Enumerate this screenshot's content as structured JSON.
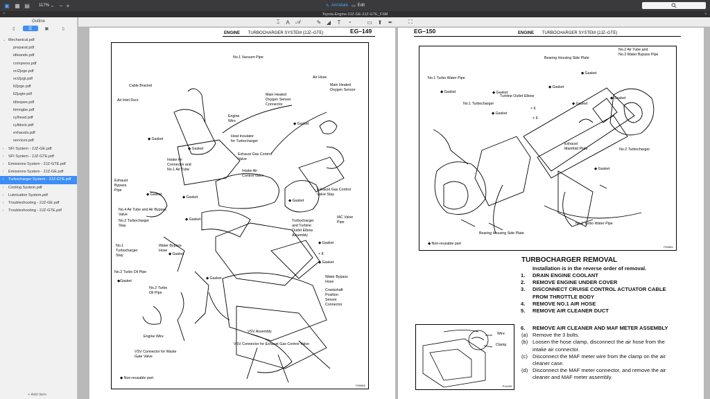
{
  "toolbar": {
    "zoom": "117%",
    "annotate_label": "Annotate",
    "edit_label": "Edit"
  },
  "window": {
    "title": "Toyota-Engine-2JZ-GE-2JZ-GTE_FSM"
  },
  "sidebar": {
    "title": "Outline",
    "items": [
      {
        "label": "Mechanical.pdf",
        "level": 0,
        "expanded": true
      },
      {
        "label": "preparat.pdf",
        "level": 1
      },
      {
        "label": "idleando.pdf",
        "level": 1
      },
      {
        "label": "compress.pdf",
        "level": 1
      },
      {
        "label": "vci2jzge.pdf",
        "level": 1
      },
      {
        "label": "vci2jzgt.pdf",
        "level": 1
      },
      {
        "label": "lt2jzge.pdf",
        "level": 1
      },
      {
        "label": "lt2jzgte.pdf",
        "level": 1
      },
      {
        "label": "idlespee.pdf",
        "level": 1
      },
      {
        "label": "timingbe.pdf",
        "level": 1
      },
      {
        "label": "cylhead.pdf",
        "level": 1
      },
      {
        "label": "cylblock.pdf",
        "level": 1
      },
      {
        "label": "exhausts.pdf",
        "level": 1
      },
      {
        "label": "services.pdf",
        "level": 1
      },
      {
        "label": "SFI System - 2JZ-GE.pdf",
        "level": 0
      },
      {
        "label": "SFI System - 2JZ-GTE.pdf",
        "level": 0
      },
      {
        "label": "Emissions System - 2JZ-GTE.pdf",
        "level": 0
      },
      {
        "label": "Emissions System - 2JZ-GE.pdf",
        "level": 0
      },
      {
        "label": "Turbocharger System - 2JZ-GTE.pdf",
        "level": 0,
        "selected": true
      },
      {
        "label": "Cooling System.pdf",
        "level": 0
      },
      {
        "label": "Lubrication System.pdf",
        "level": 0
      },
      {
        "label": "Troubleshooting - 2JZ-GE.pdf",
        "level": 0
      },
      {
        "label": "Troubleshooting - 2JZ-GTE.pdf",
        "level": 0
      }
    ],
    "add_item": "Add Item"
  },
  "left_page": {
    "page_number": "EG–149",
    "header_engine": "ENGINE",
    "header_system": "TURBOCHARGER SYSTEM (2JZ–GTE)",
    "figure_code": "P20802",
    "labels": [
      "No.1 Vacuum Pipe",
      "Cable Bracket",
      "Air Hose",
      "Main Heated",
      "Oxygen Sensor",
      "Main Heated",
      "Oxygen Sensor",
      "Connector",
      "Air Inlet Duct",
      "Engine",
      "Wire",
      "◆ Gasket",
      "◆ Gasket",
      "◆ Gasket",
      "Heat Insulator",
      "for Turbocharger",
      "Exhaust Gas Control",
      "Valve",
      "Intake Air",
      "Connector and",
      "No.1 Air Tube",
      "Intake Air",
      "Control Valve",
      "Exhaust",
      "Bypass",
      "Pipe",
      "◆ Gasket",
      "Exhaust Gas Control",
      "Valve Stay",
      "◆ Gasket",
      "◆ Gasket",
      "No.4 Air Tube and Air Bypass",
      "Valve",
      "No.2 Turbocharger",
      "Stay",
      "◆ Gasket",
      "Turbocharger",
      "and Turbine",
      "Outlet Elbow",
      "Assembly",
      "IAC Valve",
      "Pipe",
      "No.1",
      "Turbocharger",
      "Stay",
      "Water Bypass",
      "Hose",
      "◆ Gasket",
      "◆ Gasket",
      "× 8",
      "◆ Gasket",
      "No.2 Turbo Oil Pipe",
      "◆Gasket",
      "◆ Gasket",
      "No.2 Turbo",
      "Oil Pipe",
      "Water Bypass",
      "Hose",
      "Crankshaft",
      "Position",
      "Sensor",
      "Connector",
      "VSV Assembly",
      "Engine Wire",
      "VSV Connector for Waste",
      "Gate Valve",
      "VSV Connector for Exhaust Gas Control Valve",
      "◆ Non-reusable part"
    ]
  },
  "right_page": {
    "page_number": "EG–150",
    "header_engine": "ENGINE",
    "header_system": "TURBOCHARGER SYSTEM (2JZ–GTE)",
    "figure_code": "P20801",
    "labels": [
      "No.2 Air Tube and",
      "No.3 Water Bypass Pipe",
      "Bearing Housing Side Plate",
      "◆ Gasket",
      "No.1 Turbo Water Pipe",
      "◆ Gasket",
      "◆ Gasket",
      "◆ Gasket",
      "No.1 Turbocharger",
      "Turbine Outlet Elbow",
      "× 6",
      "× 6",
      "◆ Gasket",
      "◆ Gasket",
      "Exhaust",
      "Manifold Plate",
      "No.2 Turbocharger",
      "◆ Gasket",
      "◆ Gasket",
      "No.2 Turbo Water Pipe",
      "Bearing Housing Side Plate",
      "◆ Non-reusable part"
    ],
    "heading": "TURBOCHARGER REMOVAL",
    "intro": "Installation is in the reverse order of removal.",
    "steps": [
      {
        "num": "1.",
        "text": "DRAIN ENGINE COOLANT"
      },
      {
        "num": "2.",
        "text": "REMOVE ENGINE UNDER COVER"
      },
      {
        "num": "3.",
        "text": "DISCONNECT CRUISE CONTROL ACTUATOR CABLE"
      },
      {
        "num": "",
        "text": "FROM THROTTLE BODY"
      },
      {
        "num": "4.",
        "text": "REMOVE NO.1 AIR HOSE"
      },
      {
        "num": "5.",
        "text": "REMOVE AIR CLEANER DUCT"
      }
    ],
    "step6": {
      "num": "6.",
      "title": "REMOVE AIR CLEANER AND MAF METER ASSEMBLY",
      "subs": [
        {
          "num": "(a)",
          "lines": [
            "Remove the 3 bolts."
          ]
        },
        {
          "num": "(b)",
          "lines": [
            "Loosen the hose clamp, disconnect the air hose from the",
            "intake air connector."
          ]
        },
        {
          "num": "(c)",
          "lines": [
            "Disconnect the MAF meter wire from the clamp on the air",
            "cleaner case."
          ]
        },
        {
          "num": "(d)",
          "lines": [
            "Disconnect the MAF meter connector, and remove the air",
            "cleaner and MAF meter assembly."
          ]
        }
      ]
    },
    "small_figure": {
      "wire": "Wire",
      "clamp": "Clamp",
      "code": "P11439"
    }
  }
}
